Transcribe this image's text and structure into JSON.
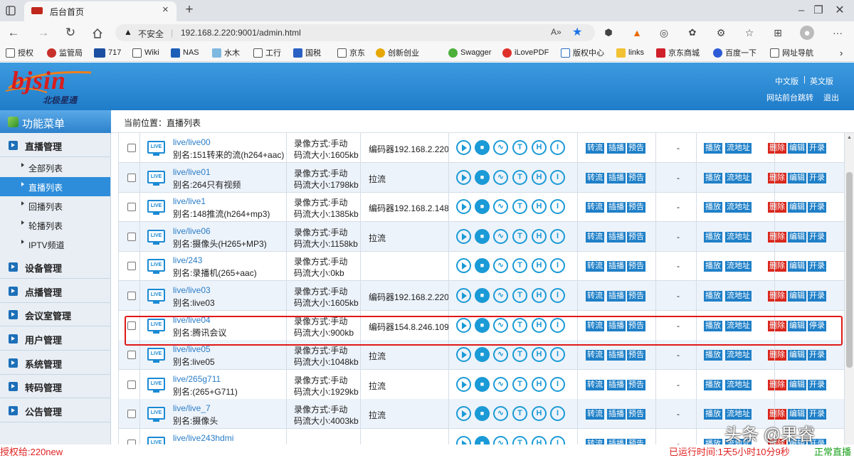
{
  "browser": {
    "tab_title": "后台首页",
    "security_label": "不安全",
    "url": "192.168.2.220:9001/admin.html",
    "bookmarks": [
      "授权",
      "监管局",
      "717",
      "Wiki",
      "NAS",
      "水木",
      "工行",
      "国税",
      "京东",
      "创新创业",
      "Swagger",
      "iLovePDF",
      "版权中心",
      "links",
      "京东商城",
      "百度一下",
      "网址导航"
    ]
  },
  "header": {
    "logo_text": "bjsin",
    "logo_sub": "北极星通",
    "lang_cn": "中文版",
    "lang_sep": "|",
    "lang_en": "英文版",
    "front_link": "网站前台跳转",
    "logout": "退出"
  },
  "sidebar": {
    "title": "功能菜单",
    "groups": [
      {
        "label": "直播管理",
        "items": [
          "全部列表",
          "直播列表",
          "回播列表",
          "轮播列表",
          "IPTV频道"
        ],
        "active": "直播列表"
      },
      {
        "label": "设备管理"
      },
      {
        "label": "点播管理"
      },
      {
        "label": "会议室管理"
      },
      {
        "label": "用户管理"
      },
      {
        "label": "系统管理"
      },
      {
        "label": "转码管理"
      },
      {
        "label": "公告管理"
      }
    ]
  },
  "breadcrumb": "当前位置：直播列表",
  "live_badge": "LIVE",
  "actions": {
    "group1": [
      "转流",
      "插播",
      "预告"
    ],
    "group2": [
      "播放",
      "流地址"
    ],
    "group3": [
      "删除",
      "编辑"
    ],
    "record_start": "开录",
    "record_stop": "停录",
    "dash": "-",
    "icon_letters": [
      "T",
      "H",
      "I"
    ]
  },
  "rows": [
    {
      "path": "live/live00",
      "alias": "别名:151转来的流(h264+aac)",
      "mode": "录像方式:手动",
      "size": "码流大小:1605kb",
      "source": "编码器192.168.2.220",
      "record": "开录"
    },
    {
      "path": "live/live01",
      "alias": "别名:264只有视频",
      "mode": "录像方式:手动",
      "size": "码流大小:1798kb",
      "source": "拉流",
      "record": "开录"
    },
    {
      "path": "live/live1",
      "alias": "别名:148推流(h264+mp3)",
      "mode": "录像方式:手动",
      "size": "码流大小:1385kb",
      "source": "编码器192.168.2.148",
      "record": "开录"
    },
    {
      "path": "live/live06",
      "alias": "别名:摄像头(H265+MP3)",
      "mode": "录像方式:手动",
      "size": "码流大小:1158kb",
      "source": "拉流",
      "record": "开录"
    },
    {
      "path": "live/243",
      "alias": "别名:录播机(265+aac)",
      "mode": "录像方式:手动",
      "size": "码流大小:0kb",
      "source": "",
      "record": "开录"
    },
    {
      "path": "live/live03",
      "alias": "别名:live03",
      "mode": "录像方式:手动",
      "size": "码流大小:1605kb",
      "source": "编码器192.168.2.220",
      "record": "开录"
    },
    {
      "path": "live/live04",
      "alias": "别名:腾讯会议",
      "mode": "录像方式:手动",
      "size": "码流大小:900kb",
      "source": "编码器154.8.246.109",
      "record": "停录"
    },
    {
      "path": "live/live05",
      "alias": "别名:live05",
      "mode": "录像方式:手动",
      "size": "码流大小:1048kb",
      "source": "拉流",
      "record": "开录"
    },
    {
      "path": "live/265g711",
      "alias": "别名:(265+G711)",
      "mode": "录像方式:手动",
      "size": "码流大小:1929kb",
      "source": "拉流",
      "record": "开录"
    },
    {
      "path": "live/live_7",
      "alias": "别名:摄像头",
      "mode": "录像方式:手动",
      "size": "码流大小:4003kb",
      "source": "拉流",
      "record": "开录"
    },
    {
      "path": "live/live243hdmi",
      "alias": "",
      "mode": "",
      "size": "",
      "source": "",
      "record": "开录"
    }
  ],
  "footer": {
    "license": "授权给:220new",
    "uptime": "已运行时间:1天5小时10分9秒",
    "status": "正常直播"
  },
  "watermark": "头条 @果睿",
  "colors": {
    "accent": "#1f80c8",
    "header": "#2d86d2",
    "danger": "#d9261c",
    "highlight": "#e01818"
  }
}
